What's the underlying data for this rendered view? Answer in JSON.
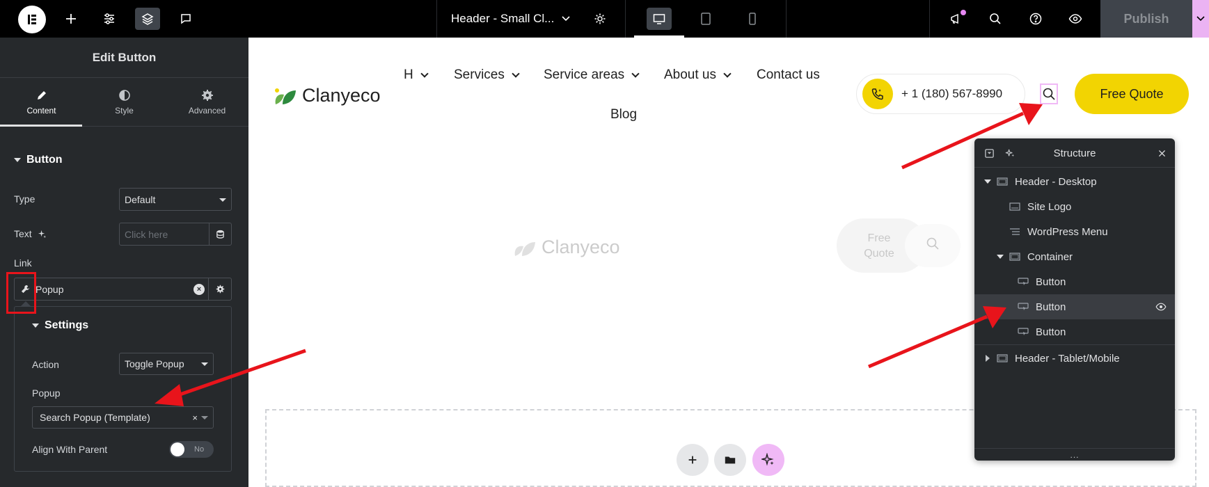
{
  "topbar": {
    "title": "Header - Small Cl...",
    "publish_label": "Publish"
  },
  "panel": {
    "header_title": "Edit Button",
    "tabs": [
      {
        "label": "Content"
      },
      {
        "label": "Style"
      },
      {
        "label": "Advanced"
      }
    ],
    "section_title": "Button",
    "type_label": "Type",
    "type_value": "Default",
    "text_label": "Text",
    "text_placeholder": "Click here",
    "link_label": "Link",
    "link_value": "Popup",
    "settings": {
      "title": "Settings",
      "action_label": "Action",
      "action_value": "Toggle Popup",
      "popup_label": "Popup",
      "popup_value": "Search Popup (Template)",
      "align_label": "Align With Parent",
      "align_toggle": "No"
    }
  },
  "site": {
    "logo_text": "Clanyeco",
    "nav": [
      {
        "label": "H"
      },
      {
        "label": "Services"
      },
      {
        "label": "Service areas"
      },
      {
        "label": "About us"
      },
      {
        "label": "Contact us"
      },
      {
        "label": "Blog"
      }
    ],
    "phone": "+ 1 (180) 567-8990",
    "cta": "Free Quote",
    "faded_logo": "Clanyeco",
    "faded_cta": "Free Quote"
  },
  "structure": {
    "title": "Structure",
    "rows": [
      {
        "label": "Header - Desktop"
      },
      {
        "label": "Site Logo"
      },
      {
        "label": "WordPress Menu"
      },
      {
        "label": "Container"
      },
      {
        "label": "Button"
      },
      {
        "label": "Button"
      },
      {
        "label": "Button"
      },
      {
        "label": "Header - Tablet/Mobile"
      }
    ],
    "footer": "..."
  },
  "colors": {
    "accent_yellow": "#f2d402",
    "panel_bg": "#26292c",
    "annotation_red": "#e8141b",
    "ai_pink": "#f0b9f6"
  }
}
